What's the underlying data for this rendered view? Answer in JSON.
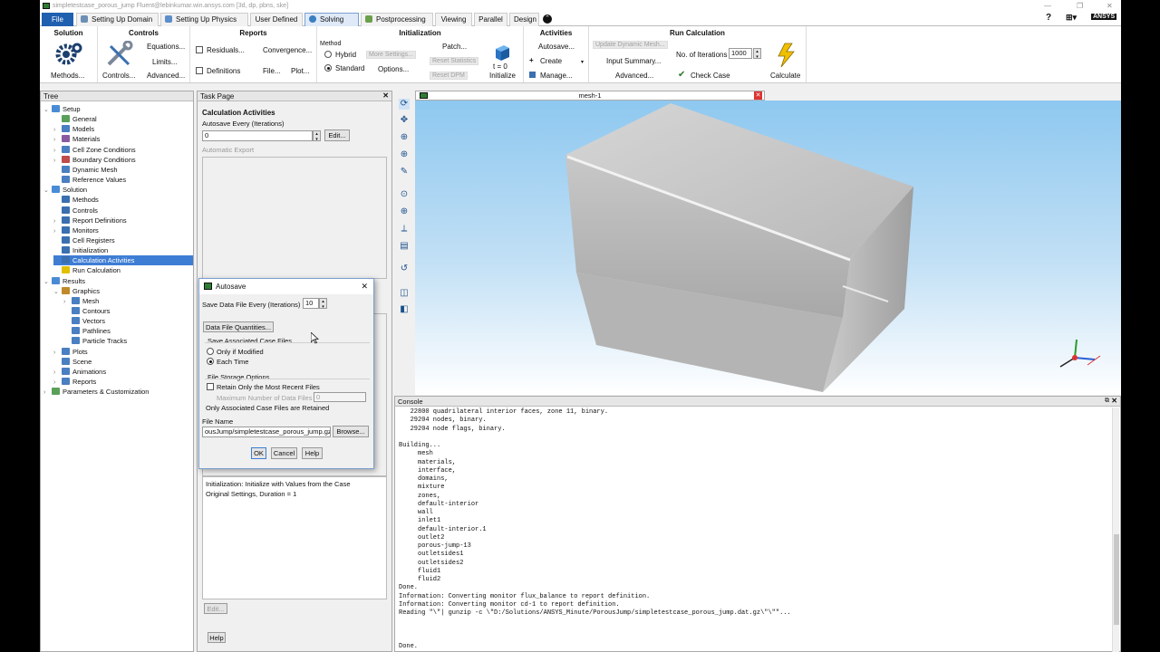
{
  "window": {
    "title": "simpletestcase_porous_jump Fluent@lebinkumar.win.ansys.com  [3d, dp, pbns, ske]"
  },
  "menu_tabs": [
    {
      "label": "File"
    },
    {
      "label": "Setting Up Domain"
    },
    {
      "label": "Setting Up Physics"
    },
    {
      "label": "User Defined"
    },
    {
      "label": "Solving"
    },
    {
      "label": "Postprocessing"
    },
    {
      "label": "Viewing"
    },
    {
      "label": "Parallel"
    },
    {
      "label": "Design"
    }
  ],
  "brand": "ANSYS",
  "ribbon": {
    "solution": {
      "title": "Solution",
      "methods": "Methods..."
    },
    "controls": {
      "title": "Controls",
      "controls": "Controls...",
      "equations": "Equations...",
      "limits": "Limits...",
      "advanced": "Advanced..."
    },
    "reports": {
      "title": "Reports",
      "residuals": "Residuals...",
      "convergence": "Convergence...",
      "definitions": "Definitions",
      "file": "File...",
      "plot": "Plot..."
    },
    "initialization": {
      "title": "Initialization",
      "method": "Method",
      "hybrid": "Hybrid",
      "standard": "Standard",
      "more_settings": "More Settings...",
      "options": "Options...",
      "patch": "Patch...",
      "reset_statistics": "Reset Statistics",
      "reset_dpm": "Reset DPM",
      "t_label": "t = 0",
      "initialize": "Initialize"
    },
    "activities": {
      "title": "Activities",
      "autosave": "Autosave...",
      "create": "Create",
      "manage": "Manage..."
    },
    "run": {
      "title": "Run Calculation",
      "update_dynamic_mesh": "Update Dynamic Mesh...",
      "input_summary": "Input Summary...",
      "advanced": "Advanced...",
      "iterations_label": "No. of Iterations",
      "iterations_value": "1000",
      "check_case": "Check Case",
      "calculate": "Calculate"
    }
  },
  "tree": {
    "title": "Tree",
    "items": [
      {
        "label": "Setup",
        "level": 0,
        "toggle": "⌄",
        "icon": "#4a8bd6"
      },
      {
        "label": "General",
        "level": 1,
        "toggle": "",
        "icon": "#5aa05a"
      },
      {
        "label": "Models",
        "level": 1,
        "toggle": "›",
        "icon": "#4a7fc1"
      },
      {
        "label": "Materials",
        "level": 1,
        "toggle": "›",
        "icon": "#8a5aa0"
      },
      {
        "label": "Cell Zone Conditions",
        "level": 1,
        "toggle": "›",
        "icon": "#4a7fc1"
      },
      {
        "label": "Boundary Conditions",
        "level": 1,
        "toggle": "›",
        "icon": "#c14a4a"
      },
      {
        "label": "Dynamic Mesh",
        "level": 1,
        "toggle": "",
        "icon": "#4a7fc1"
      },
      {
        "label": "Reference Values",
        "level": 1,
        "toggle": "",
        "icon": "#4a7fc1"
      },
      {
        "label": "Solution",
        "level": 0,
        "toggle": "⌄",
        "icon": "#4a8bd6"
      },
      {
        "label": "Methods",
        "level": 1,
        "toggle": "",
        "icon": "#3a6fb0"
      },
      {
        "label": "Controls",
        "level": 1,
        "toggle": "",
        "icon": "#3a6fb0"
      },
      {
        "label": "Report Definitions",
        "level": 1,
        "toggle": "›",
        "icon": "#3a6fb0"
      },
      {
        "label": "Monitors",
        "level": 1,
        "toggle": "›",
        "icon": "#3a6fb0"
      },
      {
        "label": "Cell Registers",
        "level": 1,
        "toggle": "",
        "icon": "#3a6fb0"
      },
      {
        "label": "Initialization",
        "level": 1,
        "toggle": "",
        "icon": "#3a6fb0"
      },
      {
        "label": "Calculation Activities",
        "level": 1,
        "toggle": "›",
        "icon": "#3a6fb0",
        "selected": true
      },
      {
        "label": "Run Calculation",
        "level": 1,
        "toggle": "",
        "icon": "#e0c000"
      },
      {
        "label": "Results",
        "level": 0,
        "toggle": "⌄",
        "icon": "#4a8bd6"
      },
      {
        "label": "Graphics",
        "level": 1,
        "toggle": "⌄",
        "icon": "#c08a2a"
      },
      {
        "label": "Mesh",
        "level": 2,
        "toggle": "›",
        "icon": "#4a7fc1"
      },
      {
        "label": "Contours",
        "level": 2,
        "toggle": "",
        "icon": "#4a7fc1"
      },
      {
        "label": "Vectors",
        "level": 2,
        "toggle": "",
        "icon": "#4a7fc1"
      },
      {
        "label": "Pathlines",
        "level": 2,
        "toggle": "",
        "icon": "#4a7fc1"
      },
      {
        "label": "Particle Tracks",
        "level": 2,
        "toggle": "",
        "icon": "#4a7fc1"
      },
      {
        "label": "Plots",
        "level": 1,
        "toggle": "›",
        "icon": "#4a7fc1"
      },
      {
        "label": "Scene",
        "level": 1,
        "toggle": "",
        "icon": "#4a7fc1"
      },
      {
        "label": "Animations",
        "level": 1,
        "toggle": "›",
        "icon": "#4a7fc1"
      },
      {
        "label": "Reports",
        "level": 1,
        "toggle": "›",
        "icon": "#4a7fc1"
      },
      {
        "label": "Parameters & Customization",
        "level": 0,
        "toggle": "›",
        "icon": "#5aa05a"
      }
    ]
  },
  "task_page": {
    "title": "Task Page",
    "heading": "Calculation Activities",
    "autosave_label": "Autosave Every (Iterations)",
    "autosave_value": "0",
    "edit_button": "Edit...",
    "automatic_export": "Automatic Export",
    "init_text_line1": "Initialization: Initialize with Values from the Case",
    "init_text_line2": "Original Settings, Duration = 1",
    "edit_disabled": "Edit...",
    "help": "Help"
  },
  "autosave_dialog": {
    "title": "Autosave",
    "save_every_label": "Save Data File Every (Iterations)",
    "save_every_value": "10",
    "data_file_quantities": "Data File Quantities...",
    "associated_case_files": "Save Associated Case Files",
    "only_if_modified": "Only if Modified",
    "each_time": "Each Time",
    "file_storage_options": "File Storage Options",
    "retain_recent": "Retain Only the Most Recent Files",
    "max_data_files_label": "Maximum Number of Data Files",
    "max_data_files_value": "0",
    "retained_note": "Only Associated Case Files are Retained",
    "file_name_label": "File Name",
    "file_name_value": "ousJump/simpletestcase_porous_jump.gz",
    "browse": "Browse...",
    "ok": "OK",
    "cancel": "Cancel",
    "help": "Help"
  },
  "graphics": {
    "tab_title": "mesh-1"
  },
  "console": {
    "title": "Console",
    "lines": [
      "   22800 quadrilateral interior faces, zone 11, binary.",
      "   29204 nodes, binary.",
      "   29204 node flags, binary.",
      "",
      "Building...",
      "     mesh",
      "     materials,",
      "     interface,",
      "     domains,",
      "     mixture",
      "     zones,",
      "     default-interior",
      "     wall",
      "     inlet1",
      "     default-interior.1",
      "     outlet2",
      "     porous-jump-13",
      "     outletsides1",
      "     outletsides2",
      "     fluid1",
      "     fluid2",
      "Done.",
      "Information: Converting monitor flux_balance to report definition.",
      "Information: Converting monitor cd-1 to report definition.",
      "Reading \"\\\"| gunzip -c \\\"D:/Solutions/ANSYS_Minute/PorousJump/simpletestcase_porous_jump.dat.gz\\\"\\\"\"...",
      "",
      "",
      "",
      "Done."
    ]
  }
}
